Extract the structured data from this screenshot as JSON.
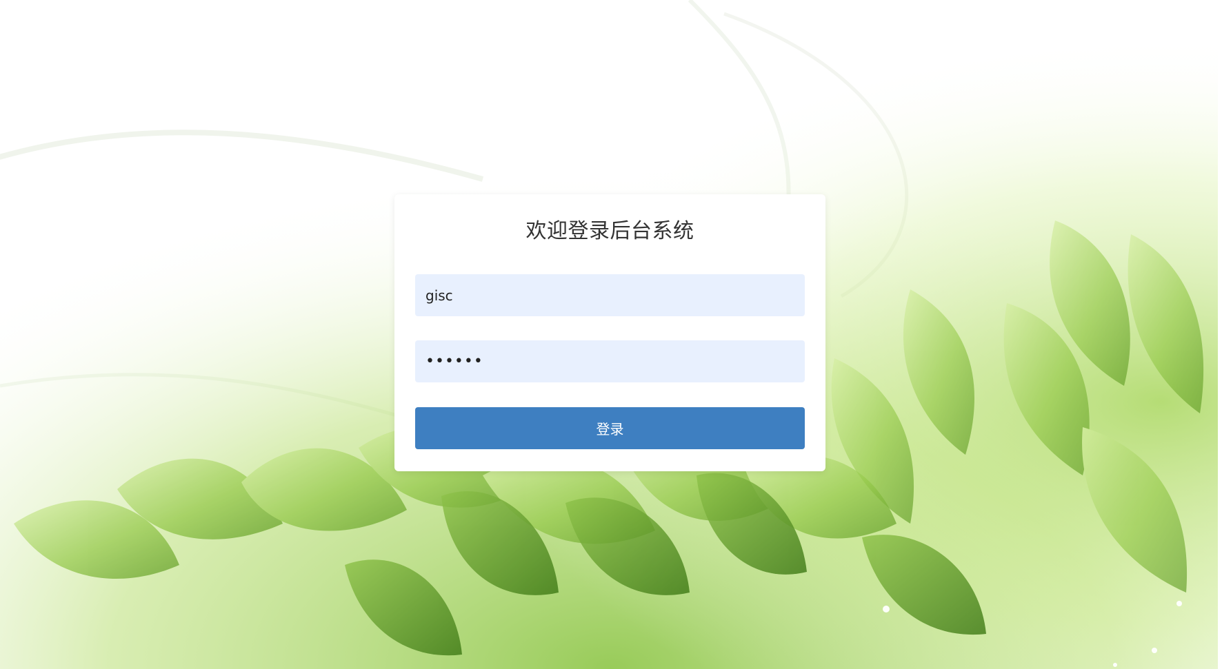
{
  "login": {
    "title": "欢迎登录后台系统",
    "username_value": "gisc",
    "password_value": "••••••",
    "submit_label": "登录"
  },
  "colors": {
    "card_background": "#ffffff",
    "input_background": "#e8f0fe",
    "button_background": "#3e7fc1",
    "button_text": "#ffffff",
    "title_text": "#333333",
    "leaf_light": "#cde98a",
    "leaf_mid": "#8dc63f",
    "leaf_dark": "#4f8f1d"
  },
  "icons": {
    "background": "green-leaves-illustration"
  }
}
